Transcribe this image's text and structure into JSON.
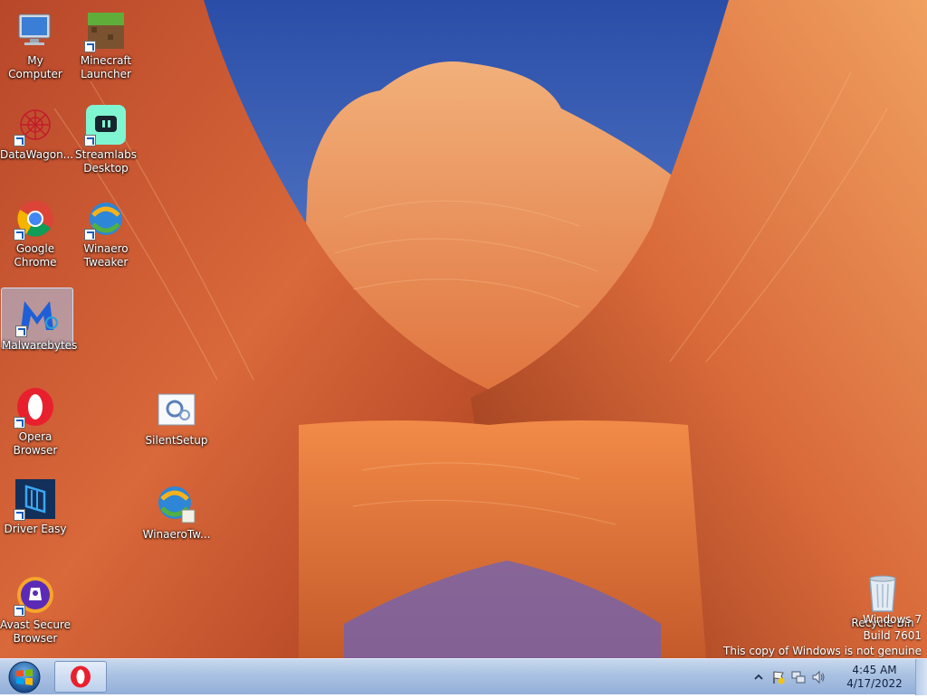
{
  "desktop": {
    "icons": [
      {
        "label": "My Computer"
      },
      {
        "label": "Minecraft Launcher"
      },
      {
        "label": "DataWagon..."
      },
      {
        "label": "Streamlabs Desktop"
      },
      {
        "label": "Google Chrome"
      },
      {
        "label": "Winaero Tweaker"
      },
      {
        "label": "Malwarebytes"
      },
      {
        "label": "Opera Browser"
      },
      {
        "label": "SilentSetup"
      },
      {
        "label": "Driver Easy"
      },
      {
        "label": "WinaeroTw..."
      },
      {
        "label": "Avast Secure Browser"
      },
      {
        "label": "Recycle Bin"
      }
    ]
  },
  "watermark": {
    "line1": "Windows 7",
    "line2": "Build 7601",
    "line3": "This copy of Windows is not genuine"
  },
  "taskbar": {
    "clock_time": "4:45 AM",
    "clock_date": "4/17/2022"
  },
  "colors": {
    "sky": "#3a62c0",
    "rock": "#d8703a",
    "taskbar": "#b3c8e6",
    "opera_red": "#e8202e"
  }
}
